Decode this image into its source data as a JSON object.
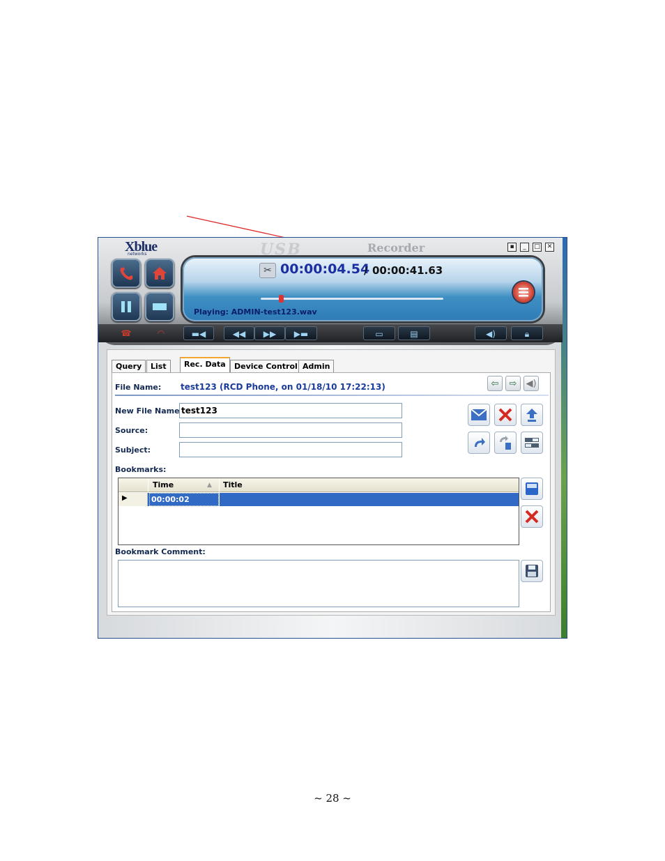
{
  "window": {
    "logo_main": "Xblue",
    "logo_sub": "networks",
    "brand_watermark": "USB",
    "brand_recorder": "Recorder",
    "window_buttons": [
      "minimize-to-tray-icon",
      "minimize-icon",
      "maximize-icon",
      "close-icon"
    ]
  },
  "player": {
    "current_time": "00:00:04.54",
    "separator": "/",
    "total_time": "00:00:41.63",
    "playing_text": "Playing: ADMIN-test123.wav",
    "seek_position": 0.1,
    "big_buttons": [
      "phone-icon",
      "home-icon",
      "pause-icon",
      "stop-icon"
    ],
    "toolbar_icons": [
      "hangup-icon",
      "headset-icon",
      "skip-to-start-icon",
      "rewind-icon",
      "fast-forward-icon",
      "skip-to-end-icon",
      "open-folder-icon",
      "export-file-icon",
      "volume-icon",
      "lock-icon"
    ]
  },
  "tabs": [
    "Query",
    "List",
    "Rec. Data",
    "Device Control",
    "Admin"
  ],
  "active_tab": "Rec. Data",
  "rec_data": {
    "file_name_label": "File Name:",
    "file_name_value": "test123 (RCD Phone, on 01/18/10 17:22:13)",
    "new_file_name_label": "New File Name:",
    "new_file_name_value": "test123",
    "source_label": "Source:",
    "source_value": "",
    "subject_label": "Subject:",
    "subject_value": "",
    "bookmarks_label": "Bookmarks:",
    "bookmark_columns": [
      "Time",
      "Title"
    ],
    "bookmark_rows": [
      {
        "time": "00:00:02",
        "title": ""
      }
    ],
    "bookmark_comment_label": "Bookmark Comment:",
    "bookmark_comment_value": ""
  },
  "page_number": "~ 28 ~",
  "colors": {
    "annotation_arrow": "#e0282a",
    "selected_row": "#316ac5",
    "time_blue": "#1b2fa0",
    "tab_active_accent": "#f2a630"
  }
}
